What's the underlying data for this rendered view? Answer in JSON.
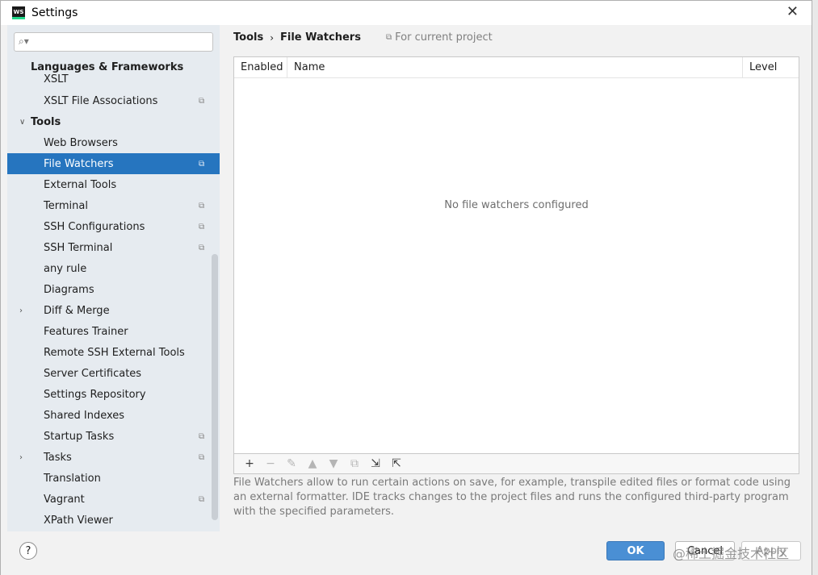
{
  "window": {
    "title": "Settings",
    "app_badge": "WS"
  },
  "search": {
    "placeholder": ""
  },
  "sidebar": {
    "group_header": "Languages & Frameworks",
    "items": [
      {
        "label": "XSLT",
        "project": false,
        "arrow": ""
      },
      {
        "label": "XSLT File Associations",
        "project": true,
        "arrow": ""
      },
      {
        "label": "Tools",
        "project": false,
        "arrow": "expanded"
      },
      {
        "label": "Web Browsers",
        "project": false,
        "arrow": ""
      },
      {
        "label": "File Watchers",
        "project": true,
        "arrow": "",
        "selected": true
      },
      {
        "label": "External Tools",
        "project": false,
        "arrow": ""
      },
      {
        "label": "Terminal",
        "project": true,
        "arrow": ""
      },
      {
        "label": "SSH Configurations",
        "project": true,
        "arrow": ""
      },
      {
        "label": "SSH Terminal",
        "project": true,
        "arrow": ""
      },
      {
        "label": "any rule",
        "project": false,
        "arrow": ""
      },
      {
        "label": "Diagrams",
        "project": false,
        "arrow": ""
      },
      {
        "label": "Diff & Merge",
        "project": false,
        "arrow": "collapsed"
      },
      {
        "label": "Features Trainer",
        "project": false,
        "arrow": ""
      },
      {
        "label": "Remote SSH External Tools",
        "project": false,
        "arrow": ""
      },
      {
        "label": "Server Certificates",
        "project": false,
        "arrow": ""
      },
      {
        "label": "Settings Repository",
        "project": false,
        "arrow": ""
      },
      {
        "label": "Shared Indexes",
        "project": false,
        "arrow": ""
      },
      {
        "label": "Startup Tasks",
        "project": true,
        "arrow": ""
      },
      {
        "label": "Tasks",
        "project": true,
        "arrow": "collapsed"
      },
      {
        "label": "Translation",
        "project": false,
        "arrow": ""
      },
      {
        "label": "Vagrant",
        "project": true,
        "arrow": ""
      },
      {
        "label": "XPath Viewer",
        "project": false,
        "arrow": ""
      }
    ]
  },
  "breadcrumb": {
    "parent": "Tools",
    "separator": "›",
    "current": "File Watchers"
  },
  "scope_label": "For current project",
  "table": {
    "columns": [
      "Enabled",
      "Name",
      "Level"
    ],
    "empty_text": "No file watchers configured"
  },
  "toolbar_icons": [
    "plus-icon",
    "minus-icon",
    "edit-icon",
    "move-up-icon",
    "move-down-icon",
    "copy-icon",
    "import-icon",
    "export-icon"
  ],
  "description": "File Watchers allow to run certain actions on save, for example, transpile edited files or format code using an external formatter. IDE tracks changes to the project files and runs the configured third-party program with the specified parameters.",
  "buttons": {
    "help": "?",
    "ok": "OK",
    "cancel": "Cancel",
    "apply": "Apply"
  },
  "watermark": "@稀土掘金技术社区",
  "colors": {
    "selection": "#2675bf",
    "ok_button": "#4a8fd4",
    "sidebar_bg": "#e6ebf0"
  }
}
